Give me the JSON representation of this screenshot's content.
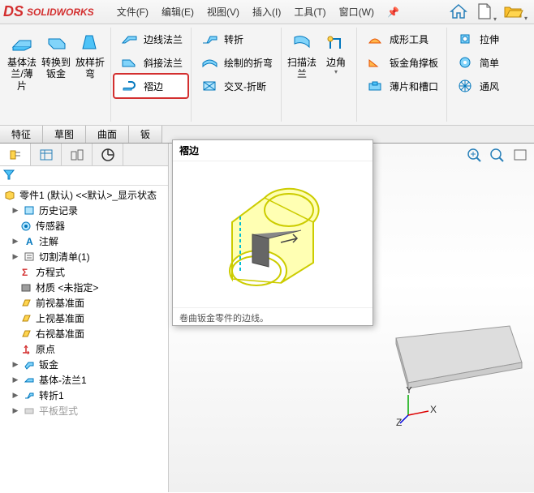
{
  "app": {
    "name": "SOLIDWORKS"
  },
  "menu": {
    "file": "文件(F)",
    "edit": "编辑(E)",
    "view": "视图(V)",
    "insert": "插入(I)",
    "tools": "工具(T)",
    "window": "窗口(W)"
  },
  "ribbon": {
    "baseFlange": "基体法兰/薄片",
    "convertToSheet": "转换到钣金",
    "loft": "放样折弯",
    "edgeFlange": "边线法兰",
    "miterFlange": "斜接法兰",
    "hem": "褶边",
    "jog": "转折",
    "sketchedBend": "绘制的折弯",
    "crossBreak": "交叉-折断",
    "sweptFlange": "扫描法兰",
    "corners": "边角",
    "formingTool": "成形工具",
    "sheetGusset": "钣金角撑板",
    "tabSlot": "薄片和槽口",
    "extrude": "拉伸",
    "simple": "简单",
    "vent": "通风"
  },
  "tabs": {
    "features": "特征",
    "sketch": "草图",
    "surfaces": "曲面",
    "sheetMetal": "钣"
  },
  "tooltip": {
    "title": "褶边",
    "desc": "卷曲钣金零件的边线。"
  },
  "tree": {
    "root": "零件1 (默认) <<默认>_显示状态",
    "history": "历史记录",
    "sensors": "传感器",
    "annotations": "注解",
    "cutList": "切割清单(1)",
    "equations": "方程式",
    "material": "材质 <未指定>",
    "frontPlane": "前视基准面",
    "topPlane": "上视基准面",
    "rightPlane": "右视基准面",
    "origin": "原点",
    "sheetMetal": "钣金",
    "baseFlange1": "基体-法兰1",
    "jog1": "转折1",
    "flatPattern": "平板型式"
  },
  "axis": {
    "x": "X",
    "y": "Y",
    "z": "Z"
  }
}
